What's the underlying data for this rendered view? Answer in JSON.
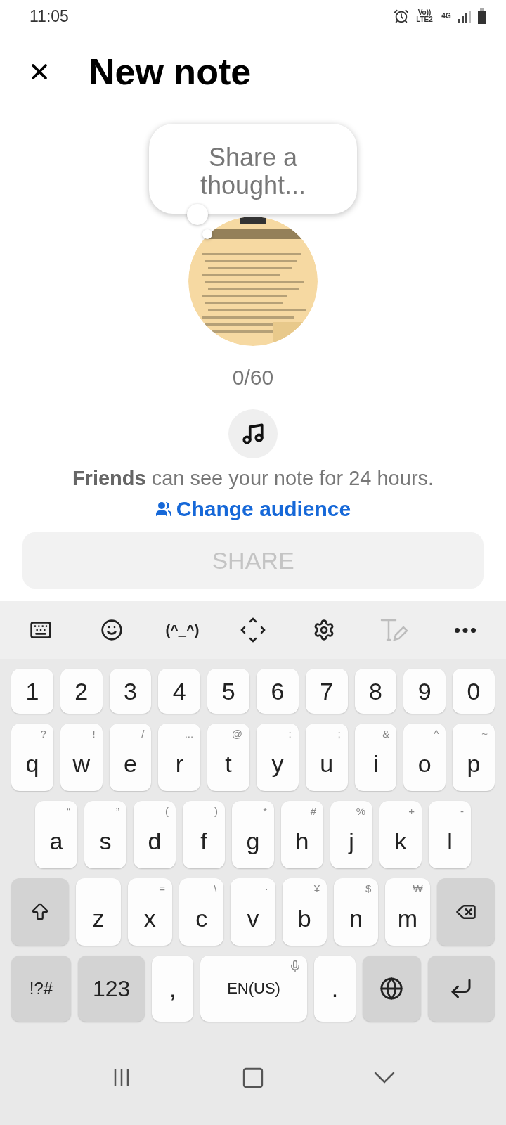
{
  "status_bar": {
    "time": "11:05",
    "network_label": "Vo)) LTE2",
    "data_label": "4G"
  },
  "header": {
    "title": "New note"
  },
  "note": {
    "placeholder": "Share a thought...",
    "counter": "0/60"
  },
  "audience": {
    "text": "**Friends** can see your note for 24 hours.",
    "link": "Change audience"
  },
  "share_button": {
    "label": "SHARE",
    "disabled": true
  },
  "keyboard": {
    "toolbar": [
      {
        "kind": "keyboard",
        "disabled": false
      },
      {
        "kind": "emoji",
        "disabled": false
      },
      {
        "kind": "kaomoji",
        "label": "(^_^)",
        "disabled": false
      },
      {
        "kind": "move",
        "disabled": false
      },
      {
        "kind": "settings",
        "disabled": false
      },
      {
        "kind": "text-style",
        "disabled": true
      },
      {
        "kind": "more",
        "disabled": false
      }
    ],
    "rows": [
      {
        "keys": [
          {
            "kind": "char",
            "label": "1"
          },
          {
            "kind": "char",
            "label": "2"
          },
          {
            "kind": "char",
            "label": "3"
          },
          {
            "kind": "char",
            "label": "4"
          },
          {
            "kind": "char",
            "label": "5"
          },
          {
            "kind": "char",
            "label": "6"
          },
          {
            "kind": "char",
            "label": "7"
          },
          {
            "kind": "char",
            "label": "8"
          },
          {
            "kind": "char",
            "label": "9"
          },
          {
            "kind": "char",
            "label": "0"
          }
        ]
      },
      {
        "keys": [
          {
            "kind": "char",
            "label": "q",
            "hint": "?"
          },
          {
            "kind": "char",
            "label": "w",
            "hint": "!"
          },
          {
            "kind": "char",
            "label": "e",
            "hint": "/"
          },
          {
            "kind": "char",
            "label": "r",
            "hint": "..."
          },
          {
            "kind": "char",
            "label": "t",
            "hint": "@"
          },
          {
            "kind": "char",
            "label": "y",
            "hint": ":"
          },
          {
            "kind": "char",
            "label": "u",
            "hint": ";"
          },
          {
            "kind": "char",
            "label": "i",
            "hint": "&"
          },
          {
            "kind": "char",
            "label": "o",
            "hint": "^"
          },
          {
            "kind": "char",
            "label": "p",
            "hint": "~"
          }
        ]
      },
      {
        "keys": [
          {
            "kind": "char",
            "label": "a",
            "hint": "“"
          },
          {
            "kind": "char",
            "label": "s",
            "hint": "”"
          },
          {
            "kind": "char",
            "label": "d",
            "hint": "("
          },
          {
            "kind": "char",
            "label": "f",
            "hint": ")"
          },
          {
            "kind": "char",
            "label": "g",
            "hint": "*"
          },
          {
            "kind": "char",
            "label": "h",
            "hint": "#"
          },
          {
            "kind": "char",
            "label": "j",
            "hint": "%"
          },
          {
            "kind": "char",
            "label": "k",
            "hint": "+"
          },
          {
            "kind": "char",
            "label": "l",
            "hint": "-"
          }
        ]
      },
      {
        "keys": [
          {
            "kind": "shift"
          },
          {
            "kind": "char",
            "label": "z",
            "hint": "_"
          },
          {
            "kind": "char",
            "label": "x",
            "hint": "="
          },
          {
            "kind": "char",
            "label": "c",
            "hint": "\\"
          },
          {
            "kind": "char",
            "label": "v",
            "hint": "·"
          },
          {
            "kind": "char",
            "label": "b",
            "hint": "¥"
          },
          {
            "kind": "char",
            "label": "n",
            "hint": "$"
          },
          {
            "kind": "char",
            "label": "m",
            "hint": "₩"
          },
          {
            "kind": "backspace"
          }
        ]
      },
      {
        "keys": [
          {
            "kind": "function",
            "label": "!?#"
          },
          {
            "kind": "function",
            "label": "123"
          },
          {
            "kind": "char",
            "label": ","
          },
          {
            "kind": "space",
            "label": "EN(US)"
          },
          {
            "kind": "char",
            "label": "."
          },
          {
            "kind": "globe"
          },
          {
            "kind": "enter"
          }
        ]
      }
    ]
  },
  "nav_bar": [
    {
      "kind": "recent"
    },
    {
      "kind": "home"
    },
    {
      "kind": "back"
    }
  ]
}
